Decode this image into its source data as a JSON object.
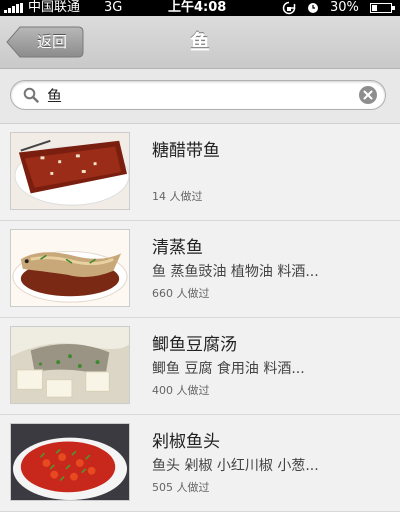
{
  "status_bar": {
    "carrier": "中国联通",
    "network": "3G",
    "time": "上午4:08",
    "battery": "30%",
    "battery_level": 0.3
  },
  "nav": {
    "back_label": "返回",
    "title": "鱼"
  },
  "search": {
    "value": "鱼"
  },
  "recipes": [
    {
      "title": "糖醋带鱼",
      "ingredients": "",
      "count": "14 人做过"
    },
    {
      "title": "清蒸鱼",
      "ingredients": "鱼 蒸鱼豉油 植物油 料酒...",
      "count": "660 人做过"
    },
    {
      "title": "鲫鱼豆腐汤",
      "ingredients": "鲫鱼 豆腐 食用油 料酒...",
      "count": "400 人做过"
    },
    {
      "title": "剁椒鱼头",
      "ingredients": "鱼头 剁椒 小红川椒 小葱...",
      "count": "505 人做过"
    }
  ]
}
